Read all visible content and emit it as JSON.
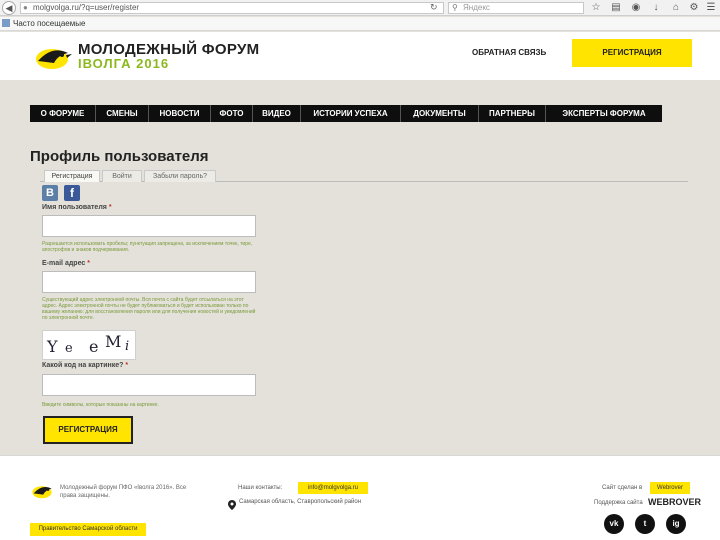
{
  "browser": {
    "url": "molgvolga.ru/?q=user/register",
    "search_placeholder": "Яндекс",
    "bookmark": "Часто посещаемые"
  },
  "header": {
    "logo_line1": "МОЛОДЕЖНЫЙ ФОРУМ",
    "logo_line2": "IВОЛГА 2016",
    "feedback": "ОБРАТНАЯ СВЯЗЬ",
    "register": "РЕГИСТРАЦИЯ"
  },
  "nav": {
    "items": [
      "О ФОРУМЕ",
      "СМЕНЫ",
      "НОВОСТИ",
      "ФОТО",
      "ВИДЕО",
      "ИСТОРИИ УСПЕХА",
      "ДОКУМЕНТЫ",
      "ПАРТНЕРЫ",
      "ЭКСПЕРТЫ ФОРУМА"
    ]
  },
  "page": {
    "title": "Профиль пользователя",
    "tabs": [
      "Регистрация",
      "Войти",
      "Забыли пароль?"
    ],
    "social": [
      "В",
      "f"
    ]
  },
  "form": {
    "username_label": "Имя пользователя",
    "username_help": "Разрешается использовать пробелы; пунктуация запрещена, за исключением точек, тире, апострофов и знаков подчеркивания.",
    "email_label": "E-mail адрес",
    "email_help": "Существующий адрес электронной почты. Вся почта с сайта будет отсылаться на этот адрес. Адрес электронной почты не будет публиковаться и будет использован только по вашему желанию: для восстановления пароля или для получения новостей и уведомлений по электронной почте.",
    "captcha_label": "Какой код на картинке?",
    "captcha_chars": [
      "Y",
      "e",
      "e",
      "M",
      "i"
    ],
    "captcha_help": "Введите символы, которые показаны на картинке.",
    "required_mark": "*",
    "submit": "РЕГИСТРАЦИЯ"
  },
  "footer": {
    "copyright": "Молодежный форум ПФО «Iволга 2016». Все права защищены.",
    "region_button": "Правительство Самарской области",
    "contacts_label": "Наши контакты:",
    "contacts_email": "info@molgvolga.ru",
    "address": "Самарская область, Ставропольский район",
    "dev_label": "Сайт сделан в",
    "dev_link": "Webrover",
    "support_label": "Поддержка сайта",
    "support_brand": "WEBROVER",
    "social": [
      "vk",
      "t",
      "ig"
    ]
  },
  "colors": {
    "accent_yellow": "#ffe400",
    "brand_green": "#8cb81e",
    "nav_black": "#0e0e0e",
    "background": "#e3e1d9"
  }
}
